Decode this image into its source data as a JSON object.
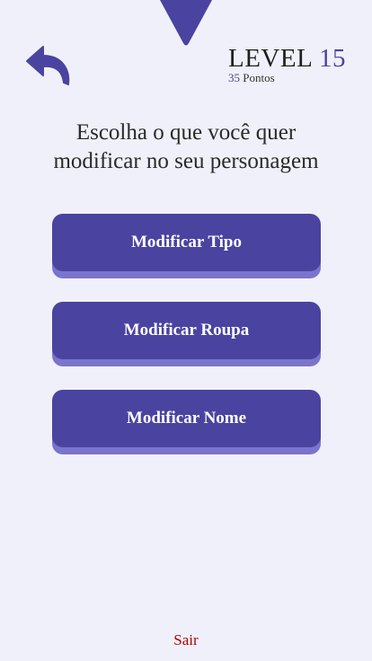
{
  "header": {
    "back_icon": "back-arrow-icon",
    "top_marker_icon": "down-triangle-marker-icon",
    "level_word": "LEVEL",
    "level_value": "15",
    "points_value": "35",
    "points_word": "Pontos"
  },
  "main": {
    "heading_line1": "Escolha o que você quer",
    "heading_line2": "modificar no seu personagem",
    "options": [
      {
        "label": "Modificar Tipo"
      },
      {
        "label": "Modificar Roupa"
      },
      {
        "label": "Modificar Nome"
      }
    ]
  },
  "footer": {
    "exit_label": "Sair"
  },
  "colors": {
    "background": "#f0f0fa",
    "accent": "#4a43a0",
    "button_shadow": "#7b74cc",
    "exit_text": "#b00000"
  }
}
